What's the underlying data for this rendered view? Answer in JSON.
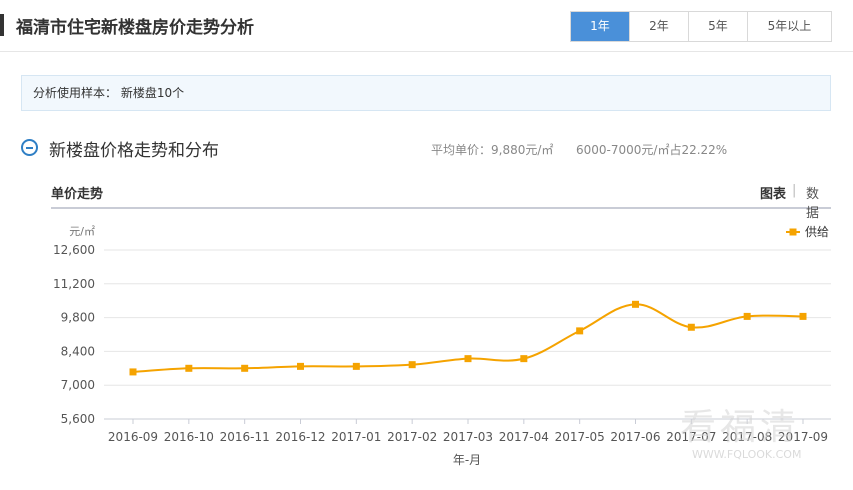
{
  "page": {
    "title": "福清市住宅新楼盘房价走势分析",
    "period_tabs": [
      {
        "label": "1年",
        "active": true
      },
      {
        "label": "2年",
        "active": false
      },
      {
        "label": "5年",
        "active": false
      },
      {
        "label": "5年以上",
        "active": false
      }
    ],
    "sample_text": "分析使用样本：  新楼盘10个"
  },
  "section": {
    "title": "新楼盘价格走势和分布",
    "avg_price": "平均单价：9,880元/㎡",
    "range_share": "6000-7000元/㎡占22.22%"
  },
  "chart_header": {
    "subtitle": "单价走势",
    "view_chart": "图表",
    "view_separator": "|",
    "view_data": "数据"
  },
  "chart_data": {
    "type": "line",
    "yunit": "元/㎡",
    "xlabel": "年-月",
    "ylim": [
      5600,
      12600
    ],
    "yticks": [
      5600,
      7000,
      8400,
      9800,
      11200,
      12600
    ],
    "ytick_labels": [
      "5,600",
      "7,000",
      "8,400",
      "9,800",
      "11,200",
      "12,600"
    ],
    "grid": true,
    "legend_position": "top-right",
    "color": "#f5a300",
    "categories": [
      "2016-09",
      "2016-10",
      "2016-11",
      "2016-12",
      "2017-01",
      "2017-02",
      "2017-03",
      "2017-04",
      "2017-05",
      "2017-06",
      "2017-07",
      "2017-08",
      "2017-09"
    ],
    "series": [
      {
        "name": "供给",
        "values": [
          7550,
          7700,
          7700,
          7780,
          7780,
          7850,
          8100,
          8100,
          9250,
          10350,
          9400,
          9850,
          9850
        ]
      }
    ]
  },
  "watermark": {
    "text": "看福清",
    "url": "WWW.FQLOOK.COM"
  }
}
